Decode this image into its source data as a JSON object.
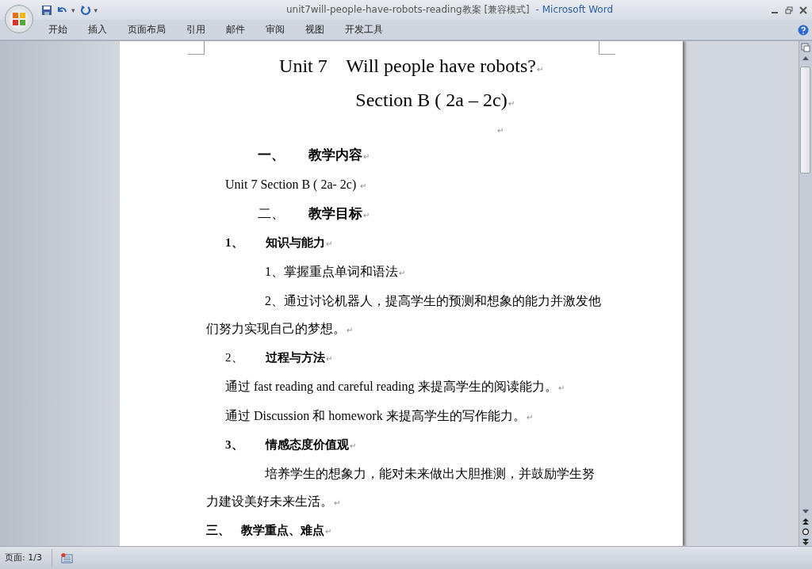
{
  "window": {
    "title": "unit7will-people-have-robots-reading教案 [兼容模式]",
    "app_name": "- Microsoft Word"
  },
  "quick_access": {
    "menu_glyph": "▾"
  },
  "tabs": [
    {
      "label": "开始"
    },
    {
      "label": "插入"
    },
    {
      "label": "页面布局"
    },
    {
      "label": "引用"
    },
    {
      "label": "邮件"
    },
    {
      "label": "审阅"
    },
    {
      "label": "视图"
    },
    {
      "label": "开发工具"
    }
  ],
  "document": {
    "paragraphs": [
      {
        "kind": "title",
        "text": "Unit 7    Will people have robots?",
        "mark": "↵"
      },
      {
        "kind": "subtitle",
        "text": "Section B ( 2a – 2c)",
        "mark": "↵"
      },
      {
        "kind": "empty",
        "mark": "↵"
      },
      {
        "kind": "heading",
        "number": "一、",
        "number_bold": true,
        "text": "教学内容",
        "mark": "↵"
      },
      {
        "kind": "body",
        "text": "Unit 7 Section B ( 2a- 2c) ",
        "mark": "↵"
      },
      {
        "kind": "heading",
        "number": "二、",
        "number_bold": false,
        "text": "教学目标",
        "mark": "↵"
      },
      {
        "kind": "subheading",
        "number": "1、",
        "number_bold": true,
        "text": "知识与能力",
        "mark": "↵"
      },
      {
        "kind": "item",
        "text": "1、掌握重点单词和语法",
        "mark": "↵"
      },
      {
        "kind": "item",
        "text": "2、通过讨论机器人，提高学生的预测和想象的能力并激发他们努力实现自己的梦想。",
        "mark": "↵"
      },
      {
        "kind": "subheading",
        "number": "2、",
        "number_bold": false,
        "text": "过程与方法",
        "mark": "↵"
      },
      {
        "kind": "body",
        "text": "通过 fast reading and careful reading 来提高学生的阅读能力。",
        "mark": "↵"
      },
      {
        "kind": "body",
        "text": "通过 Discussion 和 homework 来提高学生的写作能力。",
        "mark": "↵"
      },
      {
        "kind": "subheading",
        "number": "3、",
        "number_bold": true,
        "text": "情感态度价值观",
        "mark": "↵"
      },
      {
        "kind": "item",
        "text": "培养学生的想象力，能对未来做出大胆推测，并鼓励学生努力建设美好未来生活。",
        "mark": "↵"
      },
      {
        "kind": "section",
        "number": "三、",
        "number_bold": true,
        "text": "教学重点、难点",
        "mark": "↵"
      }
    ]
  },
  "status_bar": {
    "page": "页面: 1/3"
  }
}
